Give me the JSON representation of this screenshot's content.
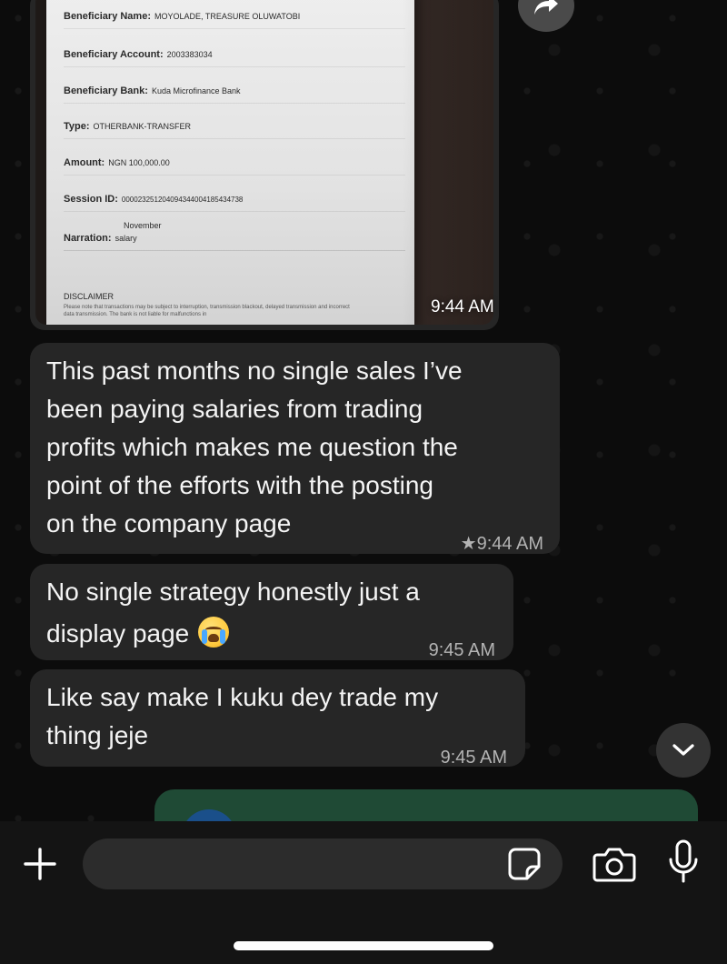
{
  "receipt": {
    "beneficiary_name_label": "Beneficiary Name:",
    "beneficiary_name": "MOYOLADE, TREASURE OLUWATOBI",
    "beneficiary_account_label": "Beneficiary Account:",
    "beneficiary_account": "2003383034",
    "beneficiary_bank_label": "Beneficiary Bank:",
    "beneficiary_bank": "Kuda Microfinance Bank",
    "type_label": "Type:",
    "type": "OTHERBANK-TRANSFER",
    "amount_label": "Amount:",
    "amount": "NGN 100,000.00",
    "session_id_label": "Session ID:",
    "session_id": "000023251204094344004185434738",
    "narration_label": "Narration:",
    "narration_line1": "November",
    "narration_line2": "salary",
    "disclaimer_title": "DISCLAIMER",
    "disclaimer_text": "Please note that transactions may be subject to interruption, transmission blackout, delayed transmission and incorrect data transmission. The bank is not liable for malfunctions in"
  },
  "image_message": {
    "time": "9:44 AM"
  },
  "messages": [
    {
      "text": "This past months no single sales I’ve\nbeen paying salaries from trading\nprofits which makes me question the\npoint of the efforts with the posting\non the company page",
      "star": "★",
      "time": "9:44 AM"
    },
    {
      "text": "No single strategy honestly just a\ndisplay page",
      "time": "9:45 AM"
    },
    {
      "text": "Like say make I kuku dey trade my\nthing jeje",
      "time": "9:45 AM"
    }
  ],
  "input": {
    "value": "",
    "placeholder": ""
  },
  "icons": {
    "forward": "forward-icon",
    "scroll_down": "chevron-down-icon",
    "plus": "plus-icon",
    "sticker": "sticker-icon",
    "camera": "camera-icon",
    "mic": "microphone-icon",
    "emoji": "loudly-crying-face-emoji"
  },
  "colors": {
    "bubble": "#262626",
    "background": "#0c0c0c",
    "card_partial": "#1f4a35"
  }
}
